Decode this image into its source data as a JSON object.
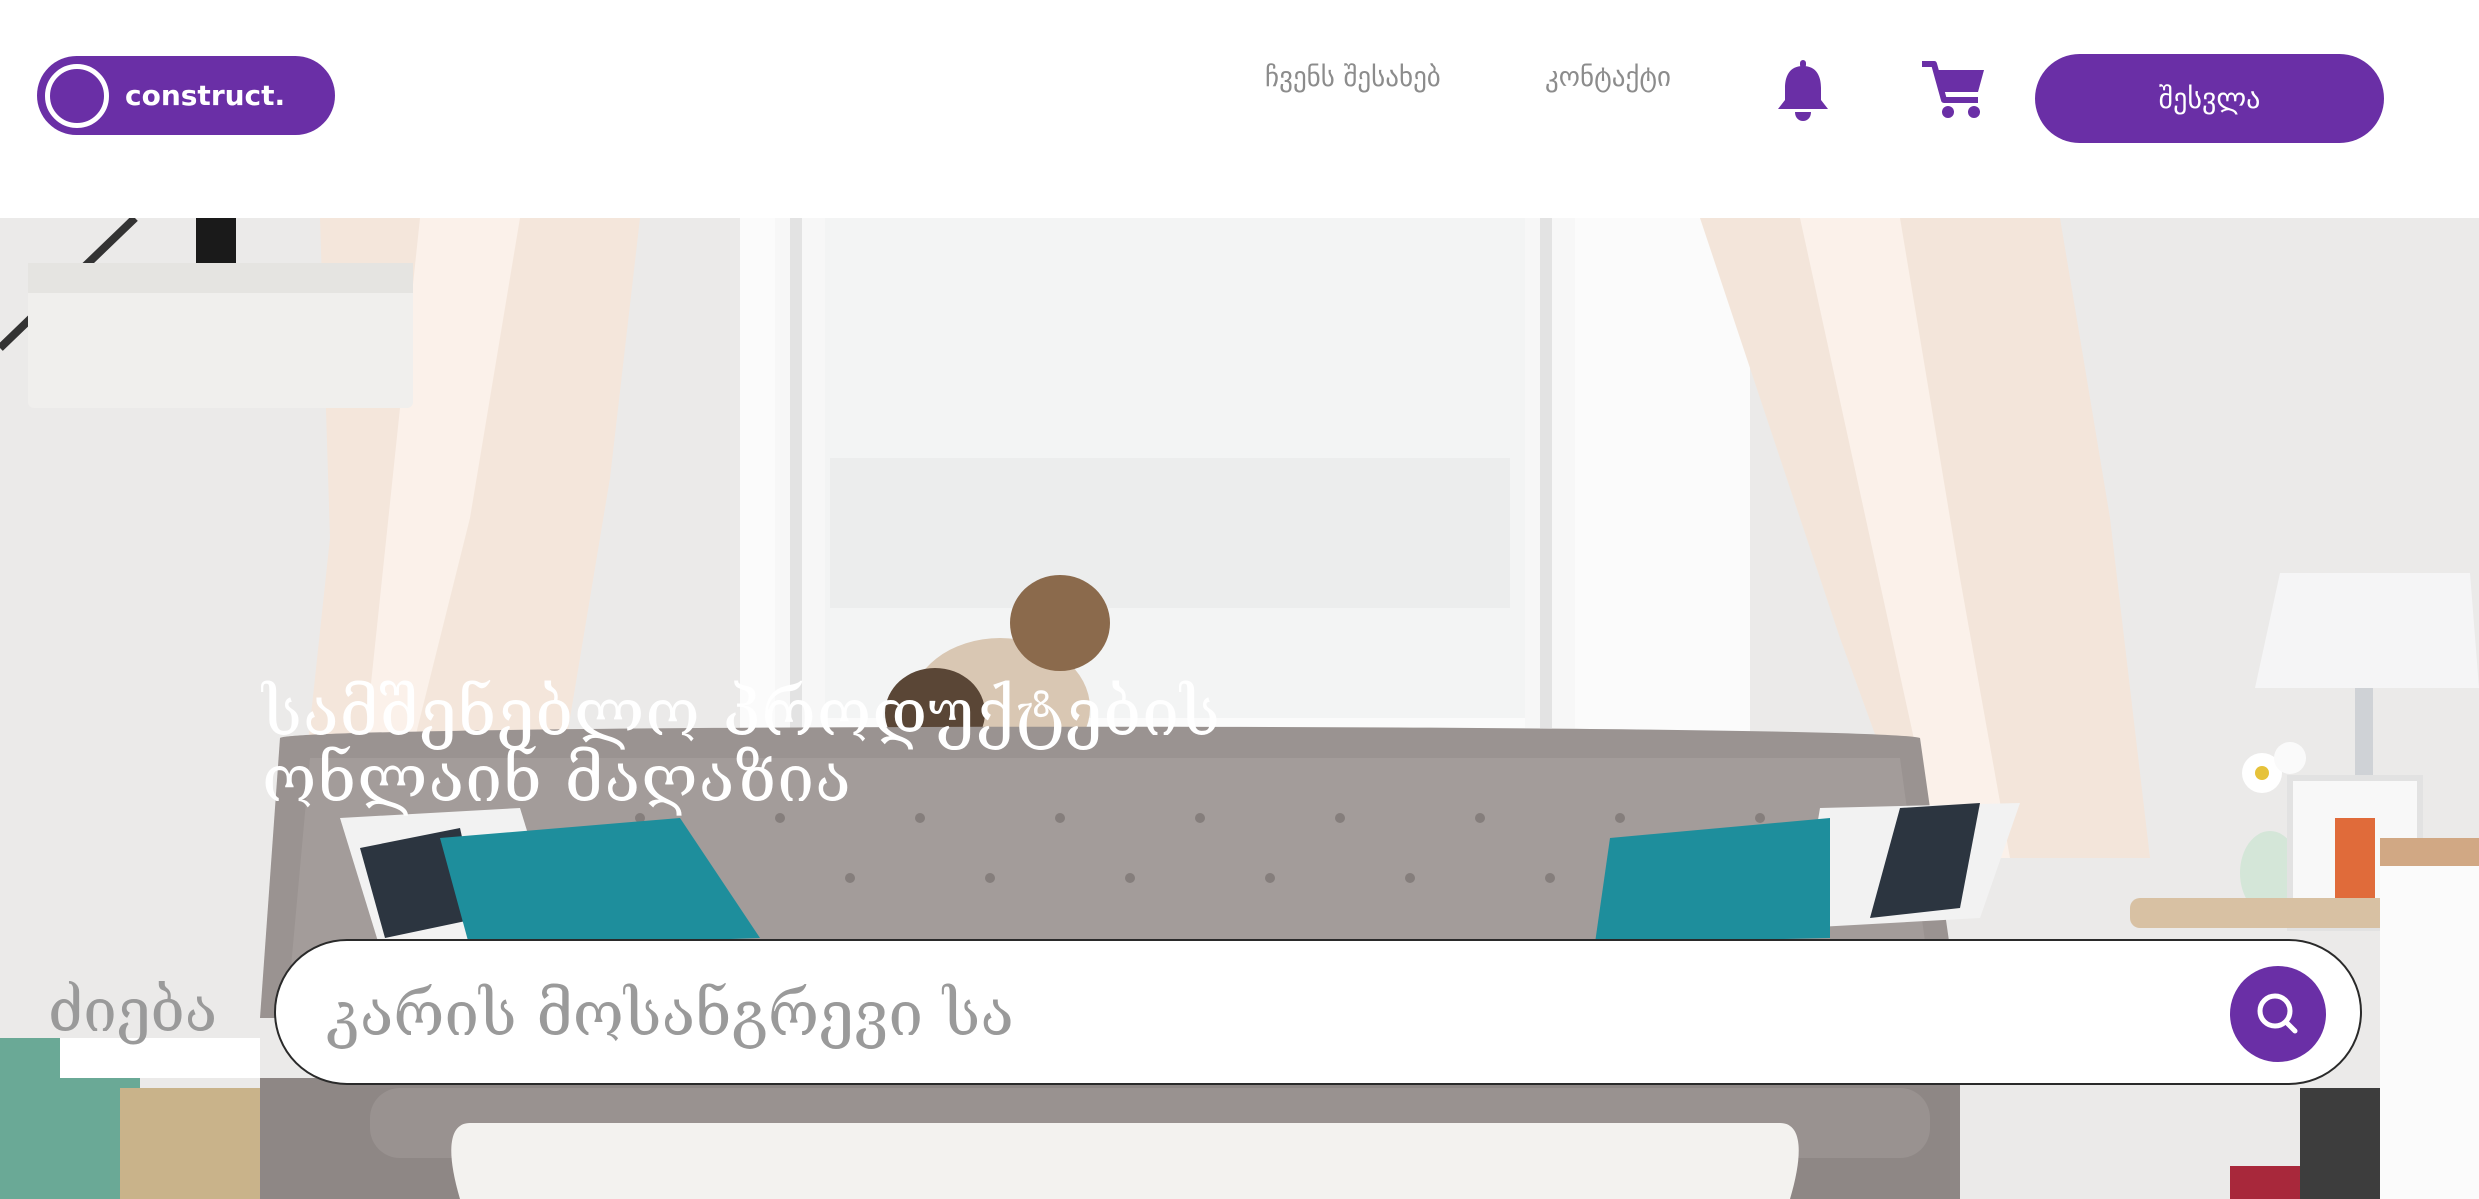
{
  "header": {
    "logo_text": "construct.",
    "nav": {
      "about_label": "ჩვენს შესახებ",
      "contact_label": "კონტაქტი"
    },
    "icons": {
      "notifications": "bell-icon",
      "cart": "shopping-cart-icon"
    },
    "login_label": "შესვლა"
  },
  "hero": {
    "title_line1": "სამშენებლო პროდუქტების",
    "title_line2": "ონლაინ მაღაზია",
    "search": {
      "label": "ძიება",
      "value": "კარის მოსანგრევი სა",
      "button_icon": "search-icon"
    }
  },
  "colors": {
    "brand": "#6a2fa6",
    "nav_text": "#8c8c8c"
  }
}
